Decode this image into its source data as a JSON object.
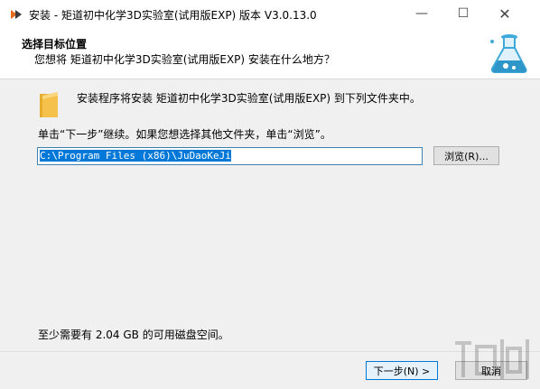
{
  "window": {
    "title": "安装 - 矩道初中化学3D实验室(试用版EXP) 版本 V3.0.13.0",
    "minimize_glyph": "—",
    "maximize_glyph": "☐",
    "close_glyph": "✕"
  },
  "header": {
    "title": "选择目标位置",
    "subtitle": "您想将 矩道初中化学3D实验室(试用版EXP) 安装在什么地方？"
  },
  "main": {
    "info": "安装程序将安装 矩道初中化学3D实验室(试用版EXP) 到下列文件夹中。",
    "hint": "单击“下一步”继续。如果您想选择其他文件夹，单击“浏览”。",
    "path_value": "C:\\Program Files (x86)\\JuDaoKeJi",
    "browse_label": "浏览(R)...",
    "space_required": "至少需要有 2.04 GB 的可用磁盘空间。"
  },
  "footer": {
    "next_label": "下一步(N) >",
    "cancel_label": "取消"
  },
  "icons": {
    "app": "installer-app-icon",
    "folder": "folder-icon",
    "header_image": "flask-icon"
  },
  "colors": {
    "accent": "#0078d7",
    "body_bg": "#f0f0f0",
    "folder": "#f5c14b"
  }
}
